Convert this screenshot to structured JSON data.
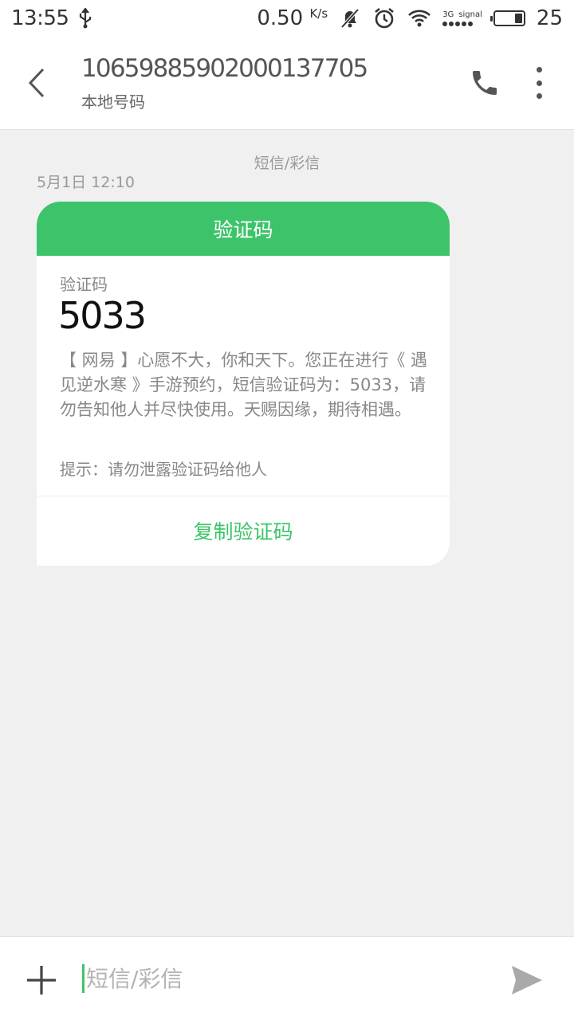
{
  "status_bar": {
    "time": "13:55",
    "net_speed": "0.50",
    "net_speed_unit": "K/s",
    "network_type": "3G",
    "signal_label": "signal",
    "battery_level": "25"
  },
  "header": {
    "title": "1065988590200013770​5",
    "subtitle": "本地号码"
  },
  "conversation": {
    "label": "短信/彩信",
    "time": "5月1日 12:10",
    "card": {
      "header": "验证码",
      "code_label": "验证码",
      "code": "5033",
      "message": "【 网易 】心愿不大，你和天下。您正在进行《 遇见逆水寒 》手游预约，短信验证码为：5033，请勿告知他人并尽快使用。天赐因缘，期待相遇。",
      "hint": "提示：请勿泄露验证码给他人",
      "copy_button": "复制验证码"
    }
  },
  "composer": {
    "placeholder": "短信/彩信"
  },
  "colors": {
    "accent": "#3dc46b",
    "background": "#f0f0f0"
  },
  "icons": {
    "back": "back-arrow-icon",
    "call": "phone-icon",
    "more": "more-vertical-icon",
    "add": "plus-icon",
    "send": "send-icon",
    "usb": "usb-icon",
    "mute": "notifications-off-icon",
    "alarm": "alarm-icon",
    "wifi": "wifi-icon"
  }
}
